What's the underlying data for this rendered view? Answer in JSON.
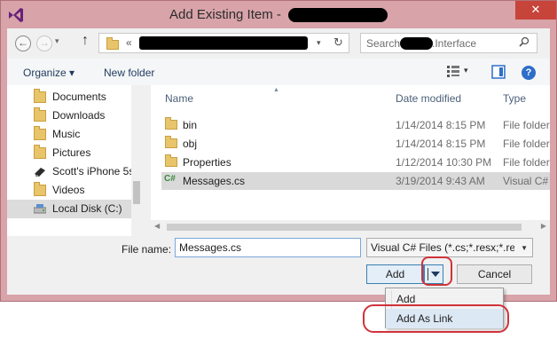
{
  "window": {
    "title": "Add Existing Item - ",
    "close_glyph": "✕"
  },
  "navigation": {
    "back_glyph": "←",
    "forward_glyph": "→",
    "dropdown_glyph": "▾",
    "up_glyph": "↑",
    "address_chevron": "«",
    "refresh_glyph": "↻"
  },
  "search": {
    "prefix": "Search",
    "suffix": ".Interface"
  },
  "toolbar": {
    "organize_label": "Organize ▾",
    "new_folder_label": "New folder"
  },
  "sidebar": {
    "items": [
      {
        "label": "Documents",
        "icon": "documents-icon"
      },
      {
        "label": "Downloads",
        "icon": "downloads-icon"
      },
      {
        "label": "Music",
        "icon": "music-icon"
      },
      {
        "label": "Pictures",
        "icon": "pictures-icon"
      },
      {
        "label": "Scott's iPhone 5s",
        "icon": "phone-icon"
      },
      {
        "label": "Videos",
        "icon": "videos-icon"
      },
      {
        "label": "Local Disk (C:)",
        "icon": "disk-icon"
      }
    ]
  },
  "files": {
    "headers": {
      "name": "Name",
      "date": "Date modified",
      "type": "Type"
    },
    "rows": [
      {
        "name": "bin",
        "date": "1/14/2014 8:15 PM",
        "type": "File folder"
      },
      {
        "name": "obj",
        "date": "1/14/2014 8:15 PM",
        "type": "File folder"
      },
      {
        "name": "Properties",
        "date": "1/12/2014 10:30 PM",
        "type": "File folder"
      },
      {
        "name": "Messages.cs",
        "date": "3/19/2014 9:43 AM",
        "type": "Visual C#"
      }
    ],
    "cs_badge": "C#"
  },
  "bottom": {
    "file_name_label": "File name:",
    "file_name_value": "Messages.cs",
    "filter_value": "Visual C# Files (*.cs;*.resx;*.resw",
    "add_label": "Add",
    "cancel_label": "Cancel"
  },
  "menu": {
    "items": [
      "Add",
      "Add As Link"
    ]
  },
  "colors": {
    "frame": "#d8a3a9",
    "close_button": "#c7443b",
    "highlight": "#d0333a",
    "folder": "#e8c46a",
    "cs_badge": "#3a8a3a"
  }
}
